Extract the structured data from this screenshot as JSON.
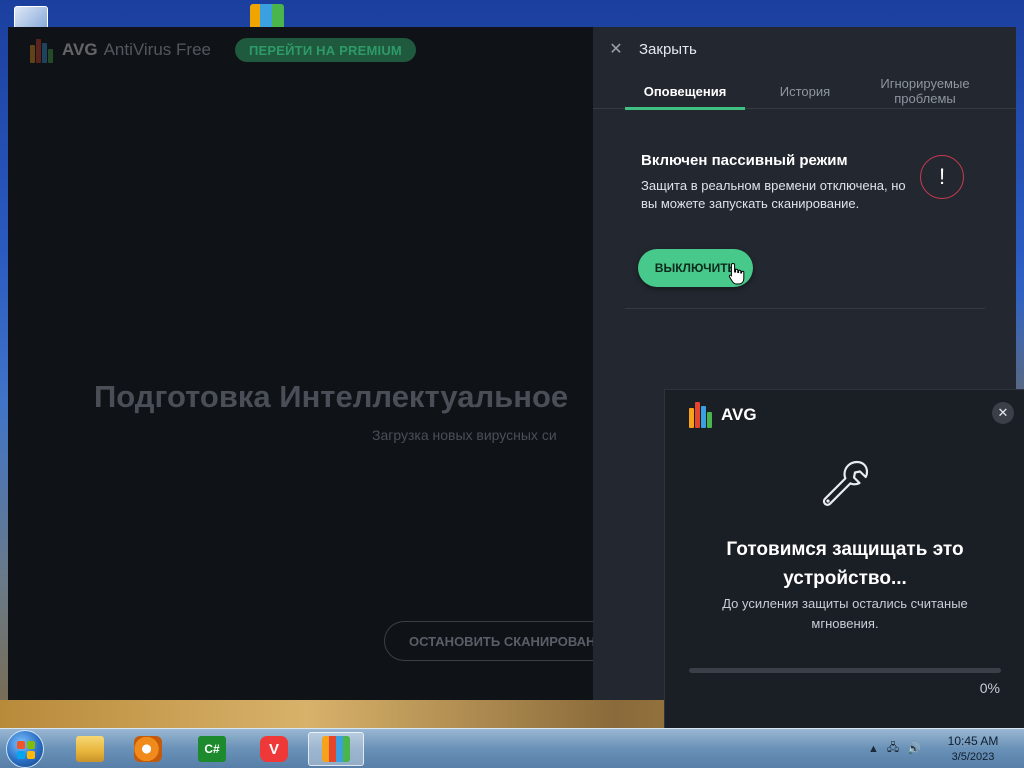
{
  "main_window": {
    "brand": "AVG",
    "product": "AntiVirus Free",
    "premium_button": "ПЕРЕЙТИ НА PREMIUM",
    "scan_title": "Подготовка Интеллектуальное",
    "scan_subtitle": "Загрузка новых вирусных си",
    "stop_button": "ОСТАНОВИТЬ СКАНИРОВАН"
  },
  "panel": {
    "close_label": "Закрыть",
    "tabs": [
      {
        "label": "Оповещения",
        "active": true
      },
      {
        "label": "История",
        "active": false
      },
      {
        "label": "Игнорируемые проблемы",
        "active": false
      }
    ],
    "notification": {
      "title": "Включен пассивный режим",
      "text": "Защита в реальном времени отключена, но вы можете запускать сканирование.",
      "button": "ВЫКЛЮЧИТЬ",
      "icon": "!"
    }
  },
  "toast": {
    "brand": "AVG",
    "title": "Готовимся защищать это устройство...",
    "text": "До усиления защиты остались считаные мгновения.",
    "progress_value": 0,
    "progress_label": "0%"
  },
  "taskbar": {
    "time": "10:45 AM",
    "date": "3/5/2023",
    "apps": [
      "explorer-icon",
      "media-player-icon",
      "csharp-icon",
      "vivaldi-icon",
      "avg-icon"
    ]
  },
  "colors": {
    "accent_green": "#46c98a",
    "warning_red": "#c93b50"
  }
}
